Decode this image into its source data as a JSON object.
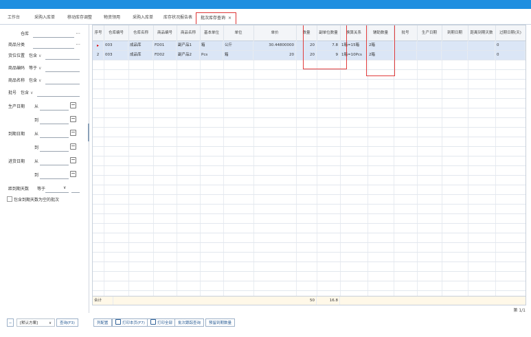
{
  "tabs": [
    {
      "label": "工作台"
    },
    {
      "label": "采购入库单"
    },
    {
      "label": "移动库存调整"
    },
    {
      "label": "物资领用"
    },
    {
      "label": "采购入库单"
    },
    {
      "label": "库存状况报告表"
    },
    {
      "label": "批次库存查询",
      "active": true
    }
  ],
  "sidebar": {
    "warehouse_label": "仓库",
    "product_category_label": "商品分类",
    "item_code_label": "货位位置",
    "item_code_op": "包含",
    "product_code_label": "商品编码",
    "product_code_op": "等于",
    "product_name_label": "商品名称",
    "product_name_op": "包含",
    "batch_label": "批号",
    "batch_op": "包含",
    "production_date_label": "生产日期",
    "expiry_label": "到期日期",
    "inbound_date_label": "进货日期",
    "from_label": "从",
    "to_label": "到",
    "remaining_days_label": "距到期天数",
    "remaining_days_op": "等于",
    "checkbox_label": "包含到期天数为空的批次",
    "dots": "...",
    "chevron": "∨"
  },
  "table": {
    "columns": [
      "序号",
      "仓库编号",
      "仓库名称",
      "商品编号",
      "商品名称",
      "基本单位",
      "单位",
      "单价",
      "数量",
      "副单位数量",
      "换算关系",
      "辅助数量",
      "批号",
      "生产日期",
      "到期日期",
      "距离到期天数",
      "过期日期(天)"
    ],
    "rows": [
      {
        "idx": "▸",
        "wh_code": "003",
        "wh_name": "成品库",
        "code": "FD01",
        "name": "副产品1",
        "unit": "箱",
        "unit2": "公斤",
        "price": "30.44800000",
        "qty": "20",
        "sub_qty": "7.8",
        "conv": "1箱=15箱",
        "aux": "2箱",
        "batch": "",
        "prod": "",
        "exp": "",
        "days": "",
        "expdays": "0"
      },
      {
        "idx": "2",
        "wh_code": "003",
        "wh_name": "成品库",
        "code": "FD02",
        "name": "副产品2",
        "unit": "Pcs",
        "unit2": "箱",
        "price": "20",
        "qty": "20",
        "sub_qty": "9",
        "conv": "1箱=10Pcs",
        "aux": "2箱",
        "batch": "",
        "prod": "",
        "exp": "",
        "days": "",
        "expdays": "0"
      }
    ],
    "sum_label": "合计",
    "sum_qty": "50",
    "sum_sub": "16.8",
    "page_info": "第 1/1"
  },
  "bottom": {
    "collapse_icon": "−",
    "scheme_label": "[默认方案]",
    "query_button": "查询(F3)",
    "reset_button": "列配置",
    "print_page_button": "打印本页(F7)",
    "print_all_button": "打印全部",
    "batch_query_button": "批次跟踪查询",
    "reserve_button": "预留到期数量"
  }
}
